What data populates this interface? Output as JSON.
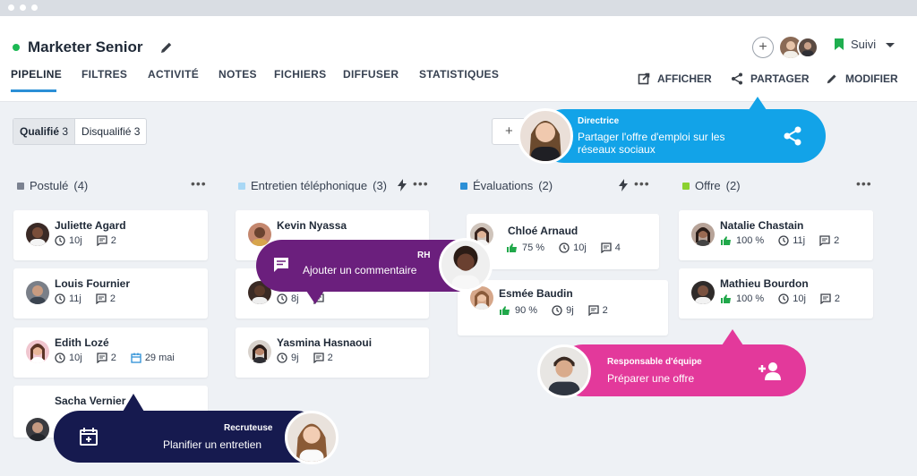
{
  "job": {
    "title": "Marketer Senior"
  },
  "tabs": [
    "PIPELINE",
    "FILTRES",
    "ACTIVITÉ",
    "NOTES",
    "FICHIERS",
    "DIFFUSER",
    "STATISTIQUES"
  ],
  "actions": {
    "afficher": "AFFICHER",
    "partager": "PARTAGER",
    "modifier": "MODIFIER"
  },
  "follow": {
    "label": "Suivi"
  },
  "segments": [
    {
      "label": "Qualifié",
      "count": "3"
    },
    {
      "label": "Disqualifié",
      "count": "3"
    }
  ],
  "add_label": "+",
  "columns": [
    {
      "name": "Postulé",
      "count": "(4)",
      "color": "#7b8290"
    },
    {
      "name": "Entretien téléphonique",
      "count": "(3)",
      "color": "#a9d8f5"
    },
    {
      "name": "Évaluations",
      "count": "(2)",
      "color": "#2b8fd6"
    },
    {
      "name": "Offre",
      "count": "(2)",
      "color": "#8bd12f"
    }
  ],
  "cards": {
    "c1": {
      "name": "Juliette Agard",
      "days": "10j",
      "comments": "2"
    },
    "c2": {
      "name": "Louis Fournier",
      "days": "11j",
      "comments": "2"
    },
    "c3": {
      "name": "Edith Lozé",
      "days": "10j",
      "comments": "2",
      "date": "29 mai"
    },
    "c4": {
      "name": "Sacha Vernier"
    },
    "c5": {
      "name": "Kevin Nyassa"
    },
    "c6": {
      "days": "8j"
    },
    "c7": {
      "name": "Yasmina Hasnaoui",
      "days": "9j",
      "comments": "2"
    },
    "c8": {
      "name": "Chloé Arnaud",
      "score": "75 %",
      "days": "10j",
      "comments": "4"
    },
    "c9": {
      "name": "Esmée Baudin",
      "score": "90 %",
      "days": "9j",
      "comments": "2"
    },
    "c10": {
      "name": "Natalie Chastain",
      "score": "100 %",
      "days": "11j",
      "comments": "2"
    },
    "c11": {
      "name": "Mathieu Bourdon",
      "score": "100 %",
      "days": "10j",
      "comments": "2"
    }
  },
  "bubbles": {
    "directrice": {
      "role": "Directrice",
      "message": "Partager l'offre d'emploi sur les réseaux sociaux",
      "color": "#12a3e8",
      "icon": "share-icon"
    },
    "rh": {
      "role": "RH",
      "message": "Ajouter un commentaire",
      "color": "#6b1f7d",
      "icon": "comment-icon"
    },
    "responsable": {
      "role": "Responsable d'équipe",
      "message": "Préparer une offre",
      "color": "#e3399b",
      "icon": "add-person-icon"
    },
    "recruteuse": {
      "role": "Recruteuse",
      "message": "Planifier un entretien",
      "color": "#161a4f",
      "icon": "calendar-add-icon"
    }
  }
}
